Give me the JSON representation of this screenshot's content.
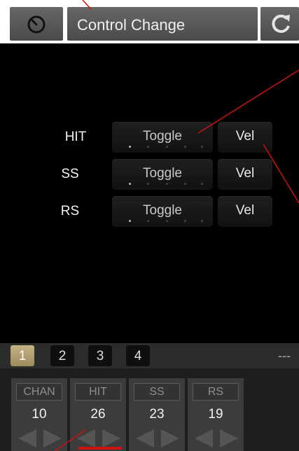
{
  "header": {
    "title": "Control Change",
    "left_icon": "tempo-dial-icon",
    "right_icon": "refresh-icon"
  },
  "rows": [
    {
      "label": "HIT",
      "mode": "Toggle",
      "value_mode": "Vel"
    },
    {
      "label": "SS",
      "mode": "Toggle",
      "value_mode": "Vel"
    },
    {
      "label": "RS",
      "mode": "Toggle",
      "value_mode": "Vel"
    }
  ],
  "banks": {
    "items": [
      "1",
      "2",
      "3",
      "4"
    ],
    "active_index": 0,
    "extra": "---"
  },
  "columns": [
    {
      "header": "CHAN",
      "value": "10"
    },
    {
      "header": "HIT",
      "value": "26"
    },
    {
      "header": "SS",
      "value": "23"
    },
    {
      "header": "RS",
      "value": "19"
    }
  ],
  "colors": {
    "accent_gold": "#b8a574",
    "annotation_red": "#d01010"
  }
}
